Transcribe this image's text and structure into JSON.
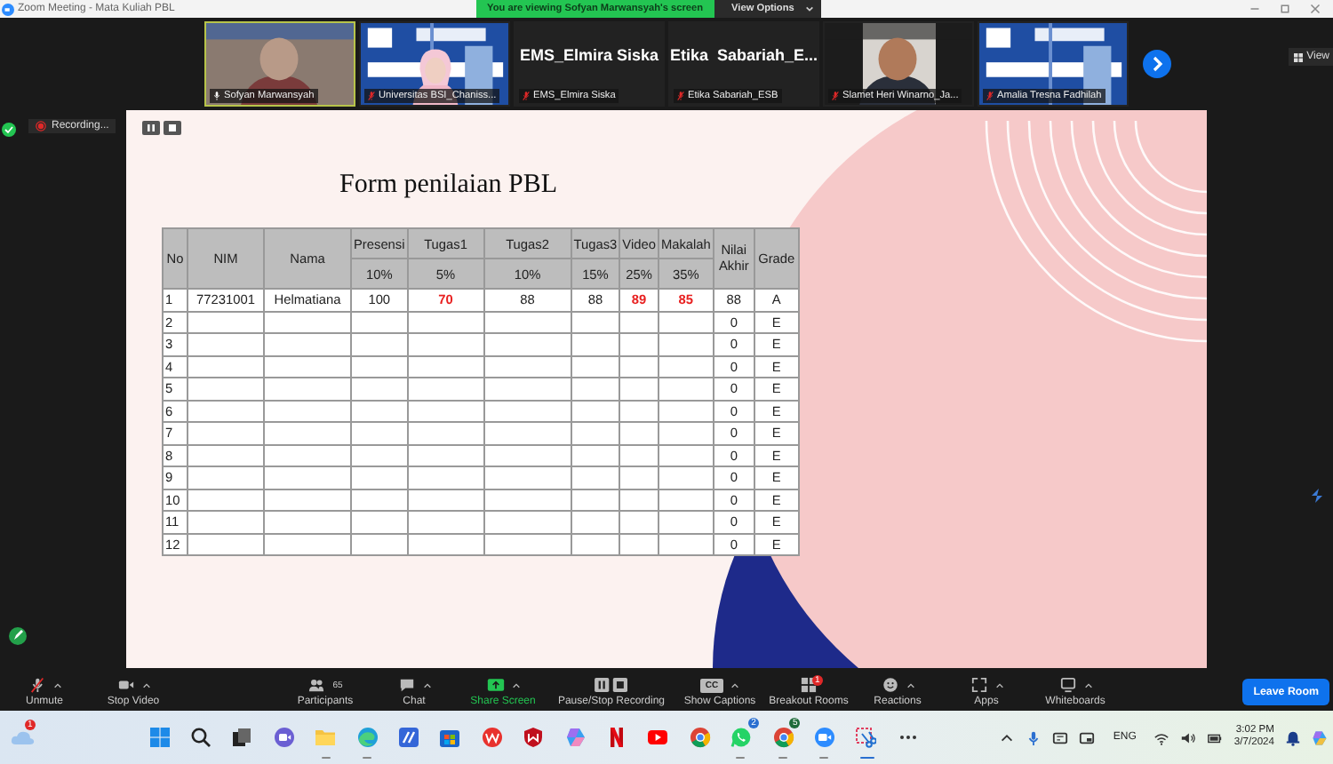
{
  "window": {
    "title": "Zoom Meeting - Mata Kuliah PBL"
  },
  "banner": {
    "text": "You are viewing Sofyan Marwansyah's screen",
    "view_options": "View Options"
  },
  "view_button": "View",
  "gallery": {
    "tiles": [
      {
        "kind": "video",
        "name": "Sofyan Marwansyah",
        "muted": false,
        "speaking": true
      },
      {
        "kind": "video",
        "name": "Universitas BSI_Chaniss...",
        "muted": true,
        "speaking": false
      },
      {
        "kind": "name",
        "display_name": "EMS_Elmira Siska",
        "name": "EMS_Elmira Siska",
        "muted": true,
        "speaking": false
      },
      {
        "kind": "name",
        "display_name": "Etika  Sabariah_E...",
        "name": "Etika Sabariah_ESB",
        "muted": true,
        "speaking": false
      },
      {
        "kind": "video",
        "name": "Slamet Heri Winarno_Ja...",
        "muted": true,
        "speaking": false
      },
      {
        "kind": "video",
        "name": "Amalia Tresna Fadhilah",
        "muted": true,
        "speaking": false
      }
    ]
  },
  "recording": {
    "label": "Recording..."
  },
  "slide": {
    "title": "Form penilaian PBL",
    "table": {
      "id_columns": [
        "No",
        "NIM",
        "Nama"
      ],
      "score_columns": [
        {
          "label": "Presensi",
          "weight": "10%"
        },
        {
          "label": "Tugas1",
          "weight": "5%"
        },
        {
          "label": "Tugas2",
          "weight": "10%"
        },
        {
          "label": "Tugas3",
          "weight": "15%"
        },
        {
          "label": "Video",
          "weight": "25%"
        },
        {
          "label": "Makalah",
          "weight": "35%"
        }
      ],
      "final_columns": [
        "Nilai Akhir",
        "Grade"
      ],
      "rows": [
        {
          "no": "1",
          "nim": "77231001",
          "nama": "Helmatiana",
          "scores": [
            {
              "value": "100",
              "emphasized": false
            },
            {
              "value": "70",
              "emphasized": true
            },
            {
              "value": "88",
              "emphasized": false
            },
            {
              "value": "88",
              "emphasized": false
            },
            {
              "value": "89",
              "emphasized": true
            },
            {
              "value": "85",
              "emphasized": true
            }
          ],
          "nilai_akhir": "88",
          "grade": "A"
        },
        {
          "no": "2",
          "nilai_akhir": "0",
          "grade": "E"
        },
        {
          "no": "3",
          "nilai_akhir": "0",
          "grade": "E"
        },
        {
          "no": "4",
          "nilai_akhir": "0",
          "grade": "E"
        },
        {
          "no": "5",
          "nilai_akhir": "0",
          "grade": "E"
        },
        {
          "no": "6",
          "nilai_akhir": "0",
          "grade": "E"
        },
        {
          "no": "7",
          "nilai_akhir": "0",
          "grade": "E"
        },
        {
          "no": "8",
          "nilai_akhir": "0",
          "grade": "E"
        },
        {
          "no": "9",
          "nilai_akhir": "0",
          "grade": "E"
        },
        {
          "no": "10",
          "nilai_akhir": "0",
          "grade": "E"
        },
        {
          "no": "11",
          "nilai_akhir": "0",
          "grade": "E"
        },
        {
          "no": "12",
          "nilai_akhir": "0",
          "grade": "E"
        }
      ]
    }
  },
  "toolbar": {
    "buttons": [
      {
        "kind": "mic_off",
        "label": "Unmute",
        "caret": true
      },
      {
        "kind": "video",
        "label": "Stop Video",
        "caret": true
      },
      {
        "kind": "participants",
        "label": "Participants",
        "count": "65",
        "caret": false
      },
      {
        "kind": "chat",
        "label": "Chat",
        "caret": true
      },
      {
        "kind": "share",
        "label": "Share Screen",
        "caret": true
      },
      {
        "kind": "record",
        "label": "Pause/Stop Recording",
        "caret": false
      },
      {
        "kind": "captions",
        "label": "Show Captions",
        "icon_text": "CC",
        "caret": true
      },
      {
        "kind": "breakout",
        "label": "Breakout Rooms",
        "badge": "1",
        "caret": false
      },
      {
        "kind": "reactions",
        "label": "Reactions",
        "caret": true
      },
      {
        "kind": "apps",
        "label": "Apps",
        "caret": true
      },
      {
        "kind": "whiteboard",
        "label": "Whiteboards",
        "caret": true
      }
    ],
    "leave": "Leave Room"
  },
  "taskbar": {
    "widget_badge": "1",
    "apps": [
      {
        "kind": "windows",
        "running": false
      },
      {
        "kind": "search",
        "running": false
      },
      {
        "kind": "taskview",
        "running": false
      },
      {
        "kind": "meet",
        "running": false
      },
      {
        "kind": "folder",
        "running": true
      },
      {
        "kind": "edge",
        "running": true
      },
      {
        "kind": "blue_app",
        "running": false
      },
      {
        "kind": "store",
        "running": false
      },
      {
        "kind": "wps",
        "running": false
      },
      {
        "kind": "shield",
        "running": false
      },
      {
        "kind": "copilot",
        "running": false
      },
      {
        "kind": "ribbon",
        "running": false
      },
      {
        "kind": "play",
        "running": false
      },
      {
        "kind": "wheel",
        "running": false
      },
      {
        "kind": "whatsapp",
        "badge": "2",
        "running": true
      },
      {
        "kind": "wheel",
        "badge": "5",
        "running": true
      },
      {
        "kind": "zoom",
        "running": true
      },
      {
        "kind": "snip",
        "running": true
      },
      {
        "kind": "more",
        "running": false
      }
    ],
    "language": "ENG",
    "time": "3:02 PM",
    "date": "3/7/2024"
  }
}
